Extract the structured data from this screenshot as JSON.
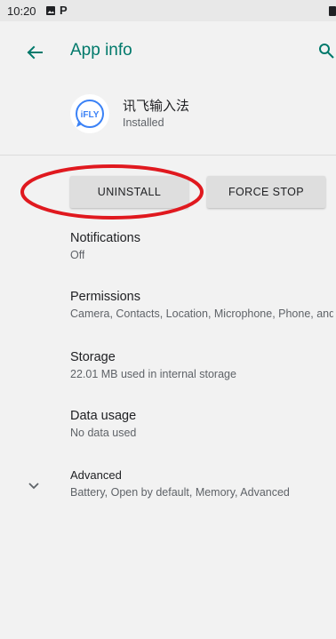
{
  "status_bar": {
    "time": "10:20",
    "p_icon": "P",
    "icons": [
      "image-icon",
      "battery-icon"
    ]
  },
  "app_bar": {
    "title": "App info",
    "back_icon": "arrow-left-icon",
    "search_icon": "search-icon"
  },
  "app": {
    "name": "讯飞输入法",
    "status": "Installed",
    "icon": "ifly-logo"
  },
  "buttons": {
    "uninstall": "UNINSTALL",
    "force_stop": "FORCE STOP"
  },
  "preferences": [
    {
      "title": "Notifications",
      "summary": "Off"
    },
    {
      "title": "Permissions",
      "summary": "Camera, Contacts, Location, Microphone, Phone, and Storage"
    },
    {
      "title": "Storage",
      "summary": "22.01 MB used in internal storage"
    },
    {
      "title": "Data usage",
      "summary": "No data used"
    },
    {
      "title": "Advanced",
      "summary": "Battery, Open by default, Memory, Advanced"
    }
  ],
  "colors": {
    "accent": "#00796b",
    "highlight": "#e0191f",
    "background": "#f2f2f2",
    "button": "#dedede",
    "app_logo": "#3b82f6"
  }
}
